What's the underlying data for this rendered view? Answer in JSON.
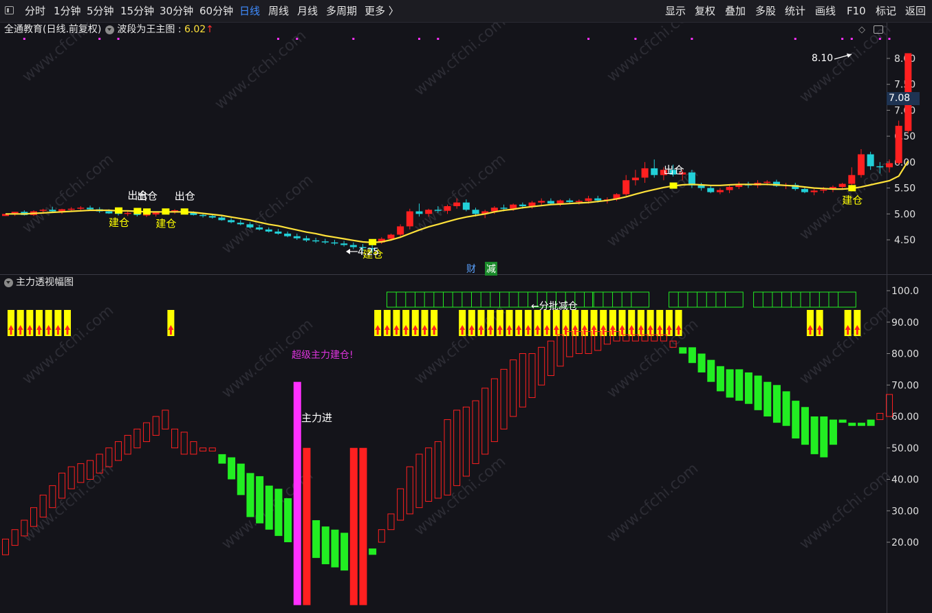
{
  "toolbar": {
    "periods": [
      {
        "label": "分时",
        "active": false
      },
      {
        "label": "1分钟",
        "active": false
      },
      {
        "label": "5分钟",
        "active": false
      },
      {
        "label": "15分钟",
        "active": false
      },
      {
        "label": "30分钟",
        "active": false
      },
      {
        "label": "60分钟",
        "active": false
      },
      {
        "label": "日线",
        "active": true
      },
      {
        "label": "周线",
        "active": false
      },
      {
        "label": "月线",
        "active": false
      },
      {
        "label": "多周期",
        "active": false
      },
      {
        "label": "更多 〉",
        "active": false
      }
    ],
    "right": [
      "显示",
      "复权",
      "叠加",
      "多股",
      "统计",
      "画线",
      "F10",
      "标记",
      "返回"
    ]
  },
  "main_chart": {
    "title": "全通教育(日线.前复权)",
    "indicator_name": "波段为王主图",
    "indicator_value": "6.02",
    "up_arrow": "↑",
    "current_price_tag": "7.08",
    "high_label": "8.10",
    "low_label": "4.25",
    "signal_labels": {
      "out": "出仓",
      "in": "建仓"
    },
    "flag_cai": "财",
    "flag_jian": "减"
  },
  "sub_chart": {
    "indicator_name": "主力透视幅图",
    "annotations": {
      "super": "超级主力建仓!",
      "enter": "主力进",
      "reduce": "←分批减仓"
    }
  },
  "colors": {
    "background": "#14141a",
    "up": "#ff2020",
    "down": "#22d0d8",
    "ma": "#ffe23a",
    "signal": "#ffff00",
    "magenta": "#ff30ff",
    "green": "#22ee22",
    "price_tag_bg": "#1e3352",
    "active_tab": "#3f8cff"
  },
  "chart_data": [
    {
      "type": "candlestick",
      "title": "全通教育(日线.前复权)",
      "y_ticks": [
        "8.00",
        "7.50",
        "7.00",
        "6.50",
        "6.00",
        "5.50",
        "5.00",
        "4.50"
      ],
      "ylim": [
        4.0,
        8.35
      ],
      "ohlc": [
        [
          4.96,
          5.0,
          4.96,
          5.0
        ],
        [
          5.0,
          5.04,
          4.96,
          5.04
        ],
        [
          5.04,
          5.07,
          4.97,
          4.98
        ],
        [
          4.98,
          5.07,
          4.96,
          5.05
        ],
        [
          5.06,
          5.1,
          5.0,
          5.08
        ],
        [
          5.08,
          5.14,
          5.02,
          5.05
        ],
        [
          5.04,
          5.1,
          5.0,
          5.09
        ],
        [
          5.08,
          5.13,
          5.04,
          5.1
        ],
        [
          5.1,
          5.15,
          5.06,
          5.12
        ],
        [
          5.12,
          5.16,
          5.06,
          5.09
        ],
        [
          5.09,
          5.13,
          5.02,
          5.05
        ],
        [
          5.05,
          5.09,
          5.0,
          5.01
        ],
        [
          5.02,
          5.06,
          4.97,
          5.0
        ],
        [
          5.0,
          5.05,
          4.96,
          5.02
        ],
        [
          5.02,
          5.05,
          4.95,
          4.98
        ],
        [
          4.98,
          5.02,
          4.94,
          4.99
        ],
        [
          4.99,
          5.03,
          4.95,
          5.03
        ],
        [
          5.03,
          5.07,
          5.0,
          5.04
        ],
        [
          5.05,
          5.09,
          5.0,
          5.07
        ],
        [
          5.07,
          5.1,
          5.02,
          5.02
        ],
        [
          5.02,
          5.05,
          4.97,
          4.98
        ],
        [
          4.98,
          5.02,
          4.93,
          4.96
        ],
        [
          4.96,
          4.99,
          4.91,
          4.93
        ],
        [
          4.93,
          4.96,
          4.87,
          4.88
        ],
        [
          4.88,
          4.92,
          4.82,
          4.84
        ],
        [
          4.83,
          4.88,
          4.78,
          4.8
        ],
        [
          4.8,
          4.84,
          4.72,
          4.74
        ],
        [
          4.74,
          4.79,
          4.68,
          4.7
        ],
        [
          4.7,
          4.74,
          4.64,
          4.66
        ],
        [
          4.66,
          4.71,
          4.6,
          4.62
        ],
        [
          4.62,
          4.66,
          4.55,
          4.57
        ],
        [
          4.57,
          4.62,
          4.5,
          4.53
        ],
        [
          4.53,
          4.58,
          4.46,
          4.49
        ],
        [
          4.49,
          4.54,
          4.44,
          4.47
        ],
        [
          4.47,
          4.52,
          4.42,
          4.45
        ],
        [
          4.45,
          4.5,
          4.4,
          4.43
        ],
        [
          4.43,
          4.48,
          4.37,
          4.4
        ],
        [
          4.4,
          4.45,
          4.32,
          4.36
        ],
        [
          4.36,
          4.42,
          4.28,
          4.34
        ],
        [
          4.34,
          4.4,
          4.25,
          4.32
        ],
        [
          4.45,
          4.55,
          4.42,
          4.52
        ],
        [
          4.52,
          4.62,
          4.48,
          4.6
        ],
        [
          4.6,
          4.8,
          4.55,
          4.76
        ],
        [
          4.76,
          5.1,
          4.7,
          5.05
        ],
        [
          5.05,
          5.2,
          4.95,
          5.0
        ],
        [
          5.0,
          5.1,
          4.95,
          5.08
        ],
        [
          5.08,
          5.15,
          5.02,
          5.06
        ],
        [
          5.06,
          5.18,
          5.0,
          5.15
        ],
        [
          5.15,
          5.3,
          5.1,
          5.22
        ],
        [
          5.22,
          5.28,
          5.05,
          5.08
        ],
        [
          5.08,
          5.12,
          4.95,
          5.0
        ],
        [
          5.0,
          5.08,
          4.92,
          5.05
        ],
        [
          5.05,
          5.15,
          5.0,
          5.12
        ],
        [
          5.12,
          5.18,
          5.05,
          5.1
        ],
        [
          5.1,
          5.2,
          5.06,
          5.18
        ],
        [
          5.18,
          5.22,
          5.1,
          5.15
        ],
        [
          5.15,
          5.25,
          5.1,
          5.22
        ],
        [
          5.22,
          5.3,
          5.15,
          5.25
        ],
        [
          5.25,
          5.3,
          5.18,
          5.2
        ],
        [
          5.2,
          5.28,
          5.15,
          5.26
        ],
        [
          5.26,
          5.3,
          5.2,
          5.23
        ],
        [
          5.23,
          5.28,
          5.18,
          5.25
        ],
        [
          5.25,
          5.35,
          5.2,
          5.3
        ],
        [
          5.3,
          5.35,
          5.22,
          5.26
        ],
        [
          5.26,
          5.32,
          5.2,
          5.28
        ],
        [
          5.28,
          5.4,
          5.25,
          5.38
        ],
        [
          5.38,
          5.75,
          5.35,
          5.65
        ],
        [
          5.65,
          5.85,
          5.55,
          5.7
        ],
        [
          5.7,
          6.0,
          5.6,
          5.88
        ],
        [
          5.88,
          6.05,
          5.7,
          5.75
        ],
        [
          5.75,
          5.9,
          5.65,
          5.85
        ],
        [
          5.85,
          5.95,
          5.72,
          5.76
        ],
        [
          5.76,
          5.85,
          5.65,
          5.8
        ],
        [
          5.8,
          5.85,
          5.5,
          5.55
        ],
        [
          5.55,
          5.6,
          5.45,
          5.5
        ],
        [
          5.5,
          5.55,
          5.4,
          5.42
        ],
        [
          5.42,
          5.5,
          5.38,
          5.46
        ],
        [
          5.46,
          5.55,
          5.4,
          5.52
        ],
        [
          5.52,
          5.62,
          5.48,
          5.58
        ],
        [
          5.58,
          5.62,
          5.5,
          5.55
        ],
        [
          5.55,
          5.65,
          5.5,
          5.6
        ],
        [
          5.6,
          5.65,
          5.55,
          5.62
        ],
        [
          5.62,
          5.66,
          5.52,
          5.54
        ],
        [
          5.54,
          5.6,
          5.48,
          5.56
        ],
        [
          5.56,
          5.6,
          5.45,
          5.48
        ],
        [
          5.48,
          5.52,
          5.4,
          5.42
        ],
        [
          5.42,
          5.48,
          5.36,
          5.45
        ],
        [
          5.45,
          5.52,
          5.4,
          5.47
        ],
        [
          5.47,
          5.55,
          5.42,
          5.52
        ],
        [
          5.52,
          5.6,
          5.48,
          5.58
        ],
        [
          5.58,
          5.9,
          5.55,
          5.75
        ],
        [
          5.75,
          6.25,
          5.7,
          6.15
        ],
        [
          6.15,
          6.2,
          5.85,
          5.92
        ],
        [
          5.92,
          6.0,
          5.78,
          5.9
        ],
        [
          5.9,
          6.05,
          5.8,
          5.98
        ],
        [
          5.98,
          6.8,
          5.95,
          6.7
        ],
        [
          6.6,
          8.1,
          6.55,
          8.1
        ]
      ],
      "ma_line": [
        5.0,
        5.0,
        5.0,
        5.01,
        5.02,
        5.03,
        5.04,
        5.05,
        5.06,
        5.07,
        5.07,
        5.07,
        5.06,
        5.06,
        5.05,
        5.04,
        5.04,
        5.04,
        5.04,
        5.04,
        5.03,
        5.01,
        4.99,
        4.97,
        4.94,
        4.91,
        4.88,
        4.84,
        4.8,
        4.77,
        4.73,
        4.69,
        4.65,
        4.62,
        4.58,
        4.55,
        4.52,
        4.49,
        4.46,
        4.45,
        4.46,
        4.5,
        4.55,
        4.62,
        4.69,
        4.75,
        4.8,
        4.85,
        4.9,
        4.94,
        4.97,
        5.0,
        5.04,
        5.07,
        5.09,
        5.12,
        5.14,
        5.16,
        5.18,
        5.19,
        5.2,
        5.21,
        5.22,
        5.24,
        5.26,
        5.29,
        5.33,
        5.38,
        5.43,
        5.47,
        5.51,
        5.54,
        5.56,
        5.57,
        5.56,
        5.55,
        5.55,
        5.56,
        5.57,
        5.57,
        5.57,
        5.57,
        5.56,
        5.55,
        5.54,
        5.52,
        5.5,
        5.49,
        5.48,
        5.48,
        5.49,
        5.52,
        5.56,
        5.6,
        5.64,
        5.73,
        6.02
      ],
      "signals": [
        {
          "i": 12,
          "type": "in"
        },
        {
          "i": 14,
          "type": "out"
        },
        {
          "i": 15,
          "type": "out"
        },
        {
          "i": 17,
          "type": "in"
        },
        {
          "i": 19,
          "type": "out"
        },
        {
          "i": 39,
          "type": "in"
        },
        {
          "i": 71,
          "type": "out"
        },
        {
          "i": 90,
          "type": "in"
        }
      ],
      "top_marks": [
        2,
        10,
        12,
        29,
        31,
        37,
        44,
        46,
        62,
        67,
        73,
        84,
        89,
        90,
        93,
        94
      ]
    },
    {
      "type": "bar",
      "title": "主力透视幅图",
      "y_ticks": [
        "100.0",
        "90.00",
        "80.00",
        "70.00",
        "60.00",
        "50.00",
        "40.00",
        "30.00",
        "20.00"
      ],
      "ylim": [
        0,
        103
      ],
      "bars": [
        [
          16,
          21,
          "r"
        ],
        [
          19,
          24,
          "r"
        ],
        [
          22,
          27,
          "r"
        ],
        [
          25,
          31,
          "r"
        ],
        [
          28,
          35,
          "r"
        ],
        [
          31,
          38,
          "r"
        ],
        [
          34,
          42,
          "r"
        ],
        [
          37,
          44,
          "r"
        ],
        [
          39,
          45,
          "r"
        ],
        [
          40,
          46,
          "r"
        ],
        [
          42,
          48,
          "r"
        ],
        [
          44,
          50,
          "r"
        ],
        [
          46,
          52,
          "r"
        ],
        [
          48,
          54,
          "r"
        ],
        [
          50,
          56,
          "r"
        ],
        [
          52,
          58,
          "r"
        ],
        [
          54,
          60,
          "r"
        ],
        [
          56,
          62,
          "r"
        ],
        [
          50,
          56,
          "r"
        ],
        [
          48,
          55,
          "r"
        ],
        [
          48,
          52,
          "r"
        ],
        [
          49,
          50,
          "r"
        ],
        [
          49,
          50,
          "r"
        ],
        [
          45,
          48,
          "G"
        ],
        [
          40,
          47,
          "G"
        ],
        [
          35,
          45,
          "G"
        ],
        [
          28,
          42,
          "G"
        ],
        [
          26,
          41,
          "G"
        ],
        [
          24,
          38,
          "G"
        ],
        [
          22,
          37,
          "G"
        ],
        [
          20,
          34,
          "G"
        ],
        [
          0,
          71,
          "M"
        ],
        [
          0,
          50,
          "R"
        ],
        [
          15,
          27,
          "G"
        ],
        [
          13,
          25,
          "G"
        ],
        [
          12,
          24,
          "G"
        ],
        [
          11,
          23,
          "G"
        ],
        [
          0,
          50,
          "R"
        ],
        [
          0,
          50,
          "R"
        ],
        [
          16,
          18,
          "G"
        ],
        [
          20,
          24,
          "r"
        ],
        [
          24,
          29,
          "r"
        ],
        [
          27,
          37,
          "r"
        ],
        [
          29,
          44,
          "r"
        ],
        [
          31,
          48,
          "r"
        ],
        [
          33,
          50,
          "r"
        ],
        [
          34,
          52,
          "r"
        ],
        [
          35,
          59,
          "r"
        ],
        [
          38,
          62,
          "r"
        ],
        [
          41,
          63,
          "r"
        ],
        [
          45,
          65,
          "r"
        ],
        [
          48,
          69,
          "r"
        ],
        [
          52,
          72,
          "r"
        ],
        [
          56,
          75,
          "r"
        ],
        [
          60,
          78,
          "r"
        ],
        [
          63,
          80,
          "r"
        ],
        [
          66,
          80,
          "r"
        ],
        [
          70,
          82,
          "r"
        ],
        [
          73,
          84,
          "r"
        ],
        [
          76,
          86,
          "r"
        ],
        [
          79,
          87,
          "r"
        ],
        [
          80,
          87,
          "r"
        ],
        [
          80,
          87,
          "r"
        ],
        [
          81,
          87,
          "r"
        ],
        [
          83,
          87,
          "r"
        ],
        [
          84,
          87,
          "r"
        ],
        [
          84,
          86,
          "r"
        ],
        [
          84,
          86,
          "r"
        ],
        [
          84,
          86,
          "r"
        ],
        [
          84,
          86,
          "r"
        ],
        [
          84,
          86,
          "r"
        ],
        [
          82,
          84,
          "r"
        ],
        [
          80,
          82,
          "G"
        ],
        [
          77,
          82,
          "G"
        ],
        [
          74,
          80,
          "G"
        ],
        [
          71,
          78,
          "G"
        ],
        [
          68,
          76,
          "G"
        ],
        [
          66,
          75,
          "G"
        ],
        [
          65,
          75,
          "G"
        ],
        [
          64,
          74,
          "G"
        ],
        [
          62,
          73,
          "G"
        ],
        [
          60,
          71,
          "G"
        ],
        [
          58,
          70,
          "G"
        ],
        [
          57,
          68,
          "G"
        ],
        [
          53,
          65,
          "G"
        ],
        [
          51,
          63,
          "G"
        ],
        [
          48,
          60,
          "G"
        ],
        [
          47,
          60,
          "G"
        ],
        [
          51,
          59,
          "G"
        ],
        [
          58,
          59,
          "G"
        ],
        [
          57,
          58,
          "G"
        ],
        [
          57,
          58,
          "G"
        ],
        [
          57,
          59,
          "G"
        ],
        [
          59,
          61,
          "r"
        ],
        [
          60,
          67,
          "r"
        ]
      ],
      "yellow_rows": [
        0,
        1,
        2,
        3,
        4,
        5,
        6,
        17,
        39,
        40,
        41,
        42,
        43,
        44,
        45,
        48,
        49,
        50,
        51,
        52,
        53,
        54,
        55,
        56,
        57,
        58,
        59,
        60,
        61,
        62,
        63,
        64,
        65,
        66,
        67,
        68,
        69,
        70,
        71,
        85,
        86,
        89,
        90
      ],
      "green_frames": [
        [
          41,
          62
        ],
        [
          62,
          68
        ],
        [
          71,
          78
        ],
        [
          80,
          90
        ]
      ]
    }
  ]
}
